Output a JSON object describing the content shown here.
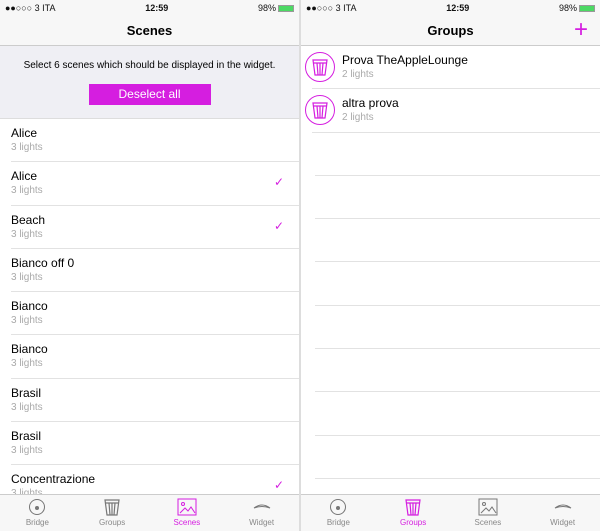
{
  "status": {
    "carrier": "●●○○○ 3 ITA",
    "time": "12:59",
    "battery": "98%"
  },
  "scenes": {
    "title": "Scenes",
    "info": "Select 6 scenes which should be displayed in the widget.",
    "deselect_label": "Deselect all",
    "items": [
      {
        "name": "Alice",
        "sub": "3 lights",
        "checked": false
      },
      {
        "name": "Alice",
        "sub": "3 lights",
        "checked": true
      },
      {
        "name": "Beach",
        "sub": "3 lights",
        "checked": true
      },
      {
        "name": "Bianco off 0",
        "sub": "3 lights",
        "checked": false
      },
      {
        "name": "Bianco",
        "sub": "3 lights",
        "checked": false
      },
      {
        "name": "Bianco",
        "sub": "3 lights",
        "checked": false
      },
      {
        "name": "Brasil",
        "sub": "3 lights",
        "checked": false
      },
      {
        "name": "Brasil",
        "sub": "3 lights",
        "checked": false
      },
      {
        "name": "Concentrazione",
        "sub": "3 lights",
        "checked": true
      }
    ]
  },
  "groups": {
    "title": "Groups",
    "add": "+",
    "items": [
      {
        "name": "Prova TheAppleLounge",
        "sub": "2 lights"
      },
      {
        "name": "altra prova",
        "sub": "2 lights"
      }
    ]
  },
  "tabs": [
    "Bridge",
    "Groups",
    "Scenes",
    "Widget"
  ],
  "accent": "#d51ee0",
  "check": "✓"
}
